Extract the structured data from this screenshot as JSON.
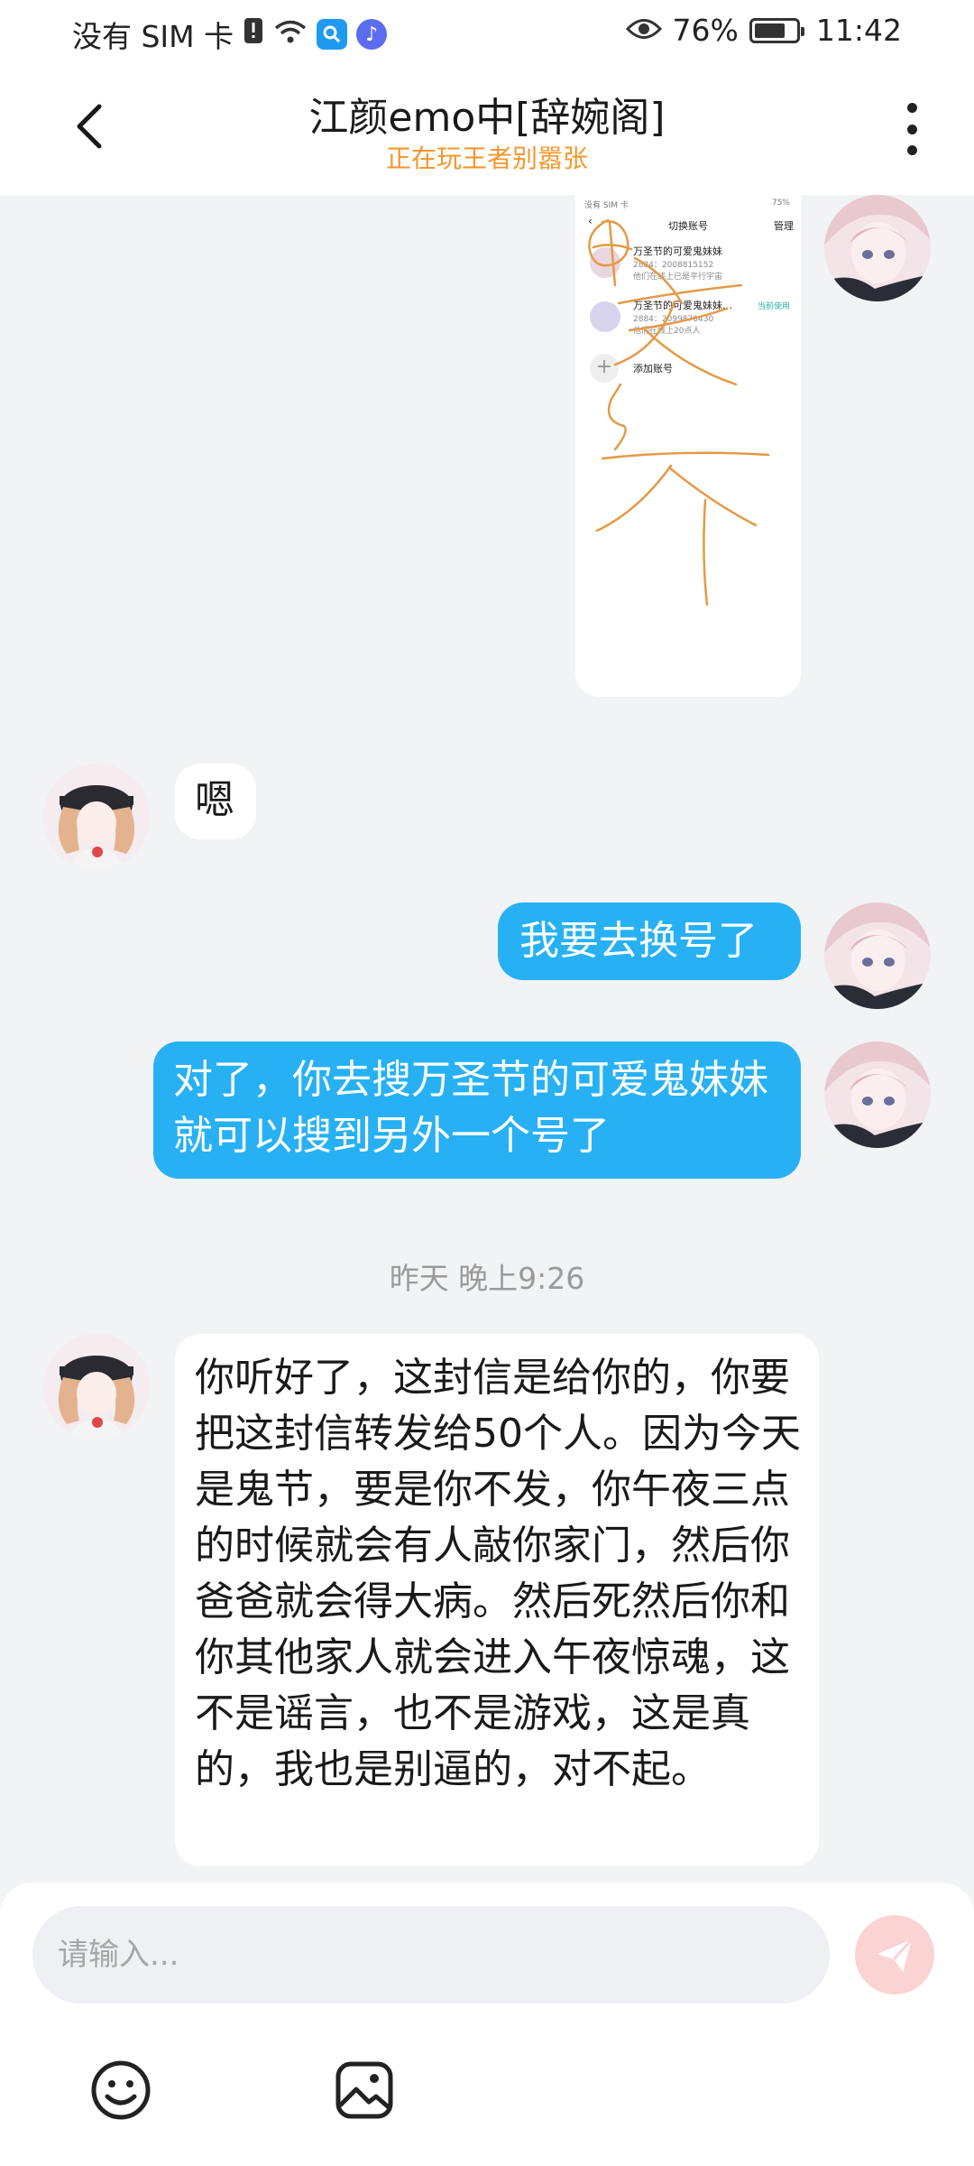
{
  "status_bar": {
    "carrier": "没有 SIM 卡",
    "battery": "76%",
    "battery_level": 0.76,
    "time": "11:42"
  },
  "header": {
    "title": "江颜emo中[辞婉阁]",
    "subtitle": "正在玩王者别嚣张"
  },
  "image_message": {
    "status_left": "没有 SIM 卡",
    "status_right": "75%",
    "title": "切换账号",
    "manage": "管理",
    "accounts": [
      {
        "name": "万圣节的可爱鬼妹妹",
        "id": "2884：2008815152",
        "note": "他们在线上已是平行宇宙"
      },
      {
        "name": "万圣节的可爱鬼妹妹的另外...",
        "id": "2884：2099870430",
        "note": "他们在线上20点人",
        "action": "当前使用"
      }
    ],
    "add_account": "添加账号"
  },
  "messages": [
    {
      "from": "other",
      "text": "嗯"
    },
    {
      "from": "me",
      "text": "我要去换号了"
    },
    {
      "from": "me",
      "text": "对了，你去搜万圣节的可爱鬼妹妹就可以搜到另外一个号了"
    },
    {
      "from": "other",
      "text": "你听好了，这封信是给你的，你要把这封信转发给50个人。因为今天是鬼节，要是你不发，你午夜三点的时候就会有人敲你家门，然后你爸爸就会得大病。然后死然后你和你其他家人就会进入午夜惊魂，这不是谣言，也不是游戏，这是真的，我也是别逼的，对不起。"
    }
  ],
  "timestamp": "昨天 晚上9:26",
  "input": {
    "placeholder": "请输入..."
  },
  "icons": {
    "back": "chevron-left-icon",
    "more": "more-vertical-icon",
    "send": "send-icon",
    "emoji": "emoji-icon",
    "image": "image-icon"
  },
  "colors": {
    "accent": "#27b1f4",
    "subtitle": "#f5962a",
    "send_disabled": "#fbd3d3"
  }
}
